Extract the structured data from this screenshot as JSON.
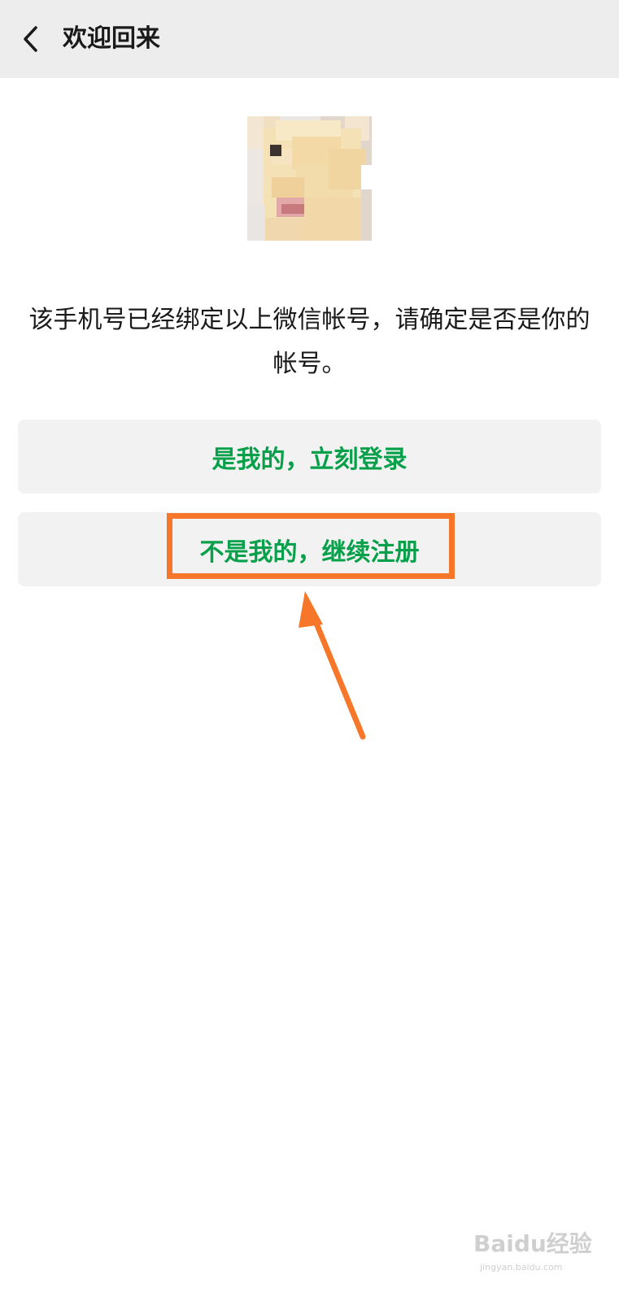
{
  "header": {
    "title": "欢迎回来",
    "back_icon": "chevron-left-icon"
  },
  "message": "该手机号已经绑定以上微信帐号，请确定是否是你的帐号。",
  "buttons": {
    "login_label": "是我的，立刻登录",
    "register_label": "不是我的，继续注册"
  },
  "colors": {
    "accent_green": "#07a04a",
    "highlight_orange": "#f6772a",
    "header_bg": "#ededed",
    "button_bg": "#f2f2f2"
  },
  "watermark": {
    "text": "Baidu经验",
    "sub": "jingyan.baidu.com"
  }
}
